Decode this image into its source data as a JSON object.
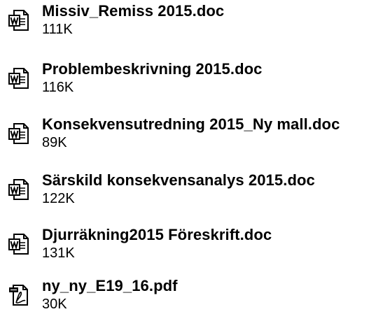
{
  "files": [
    {
      "name": "Missiv_Remiss 2015.doc",
      "size": "111K",
      "icon": "word-document-icon"
    },
    {
      "name": "Problembeskrivning 2015.doc",
      "size": "116K",
      "icon": "word-document-icon"
    },
    {
      "name": "Konsekvensutredning 2015_Ny mall.doc",
      "size": "89K",
      "icon": "word-document-icon"
    },
    {
      "name": "Särskild konsekvensanalys 2015.doc",
      "size": "122K",
      "icon": "word-document-icon"
    },
    {
      "name": "Djurräkning2015 Föreskrift.doc",
      "size": "131K",
      "icon": "word-document-icon"
    },
    {
      "name": "ny_ny_E19_16.pdf",
      "size": "30K",
      "icon": "pdf-document-icon"
    }
  ]
}
